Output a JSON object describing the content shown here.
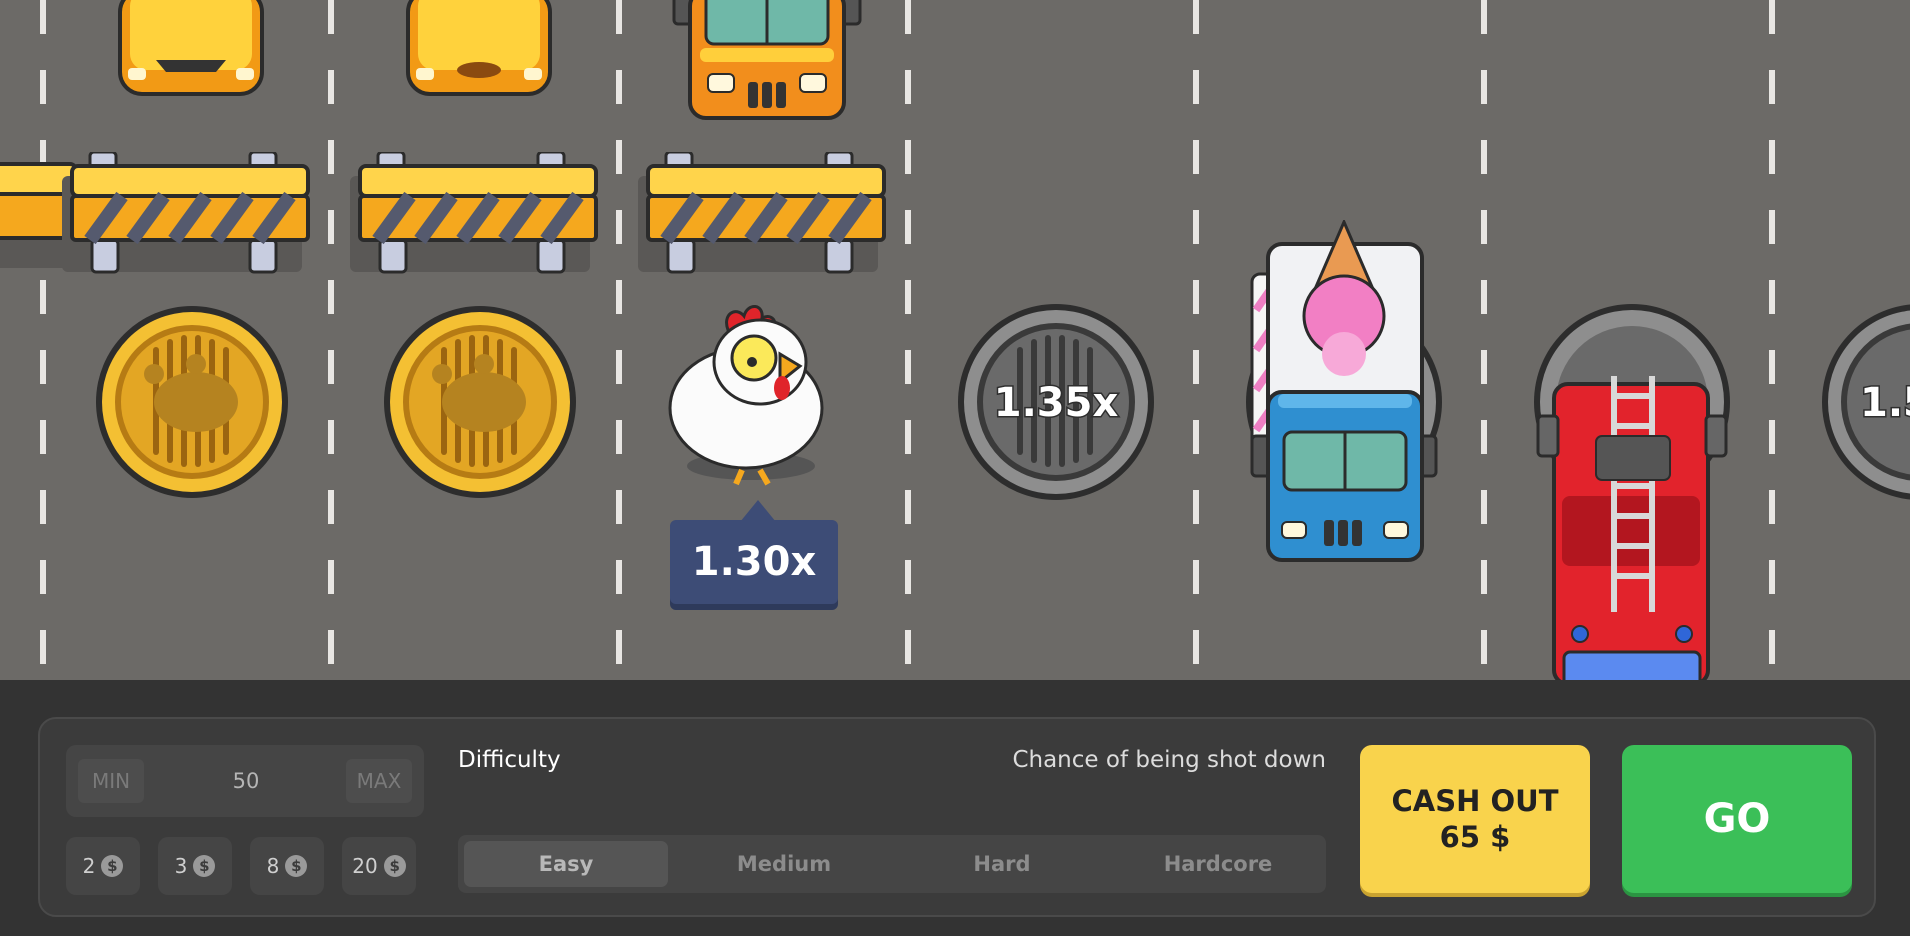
{
  "game": {
    "current_multiplier": "1.30x",
    "manholes": [
      "1.35x",
      "1.5"
    ]
  },
  "controls": {
    "min_label": "MIN",
    "max_label": "MAX",
    "bet_amount": "50",
    "quick_bets": [
      {
        "value": "2",
        "currency": "$"
      },
      {
        "value": "3",
        "currency": "$"
      },
      {
        "value": "8",
        "currency": "$"
      },
      {
        "value": "20",
        "currency": "$"
      }
    ],
    "difficulty_label": "Difficulty",
    "chance_label": "Chance of being shot down",
    "difficulties": [
      "Easy",
      "Medium",
      "Hard",
      "Hardcore"
    ],
    "selected_difficulty": "Easy",
    "cash_out_label": "CASH OUT",
    "cash_out_amount": "65 $",
    "go_label": "GO"
  },
  "colors": {
    "road": "#6c6a67",
    "panel": "#3b3b3b",
    "cash_out": "#f9d34c",
    "go": "#3bbf58",
    "tooltip": "#3d4c76"
  }
}
